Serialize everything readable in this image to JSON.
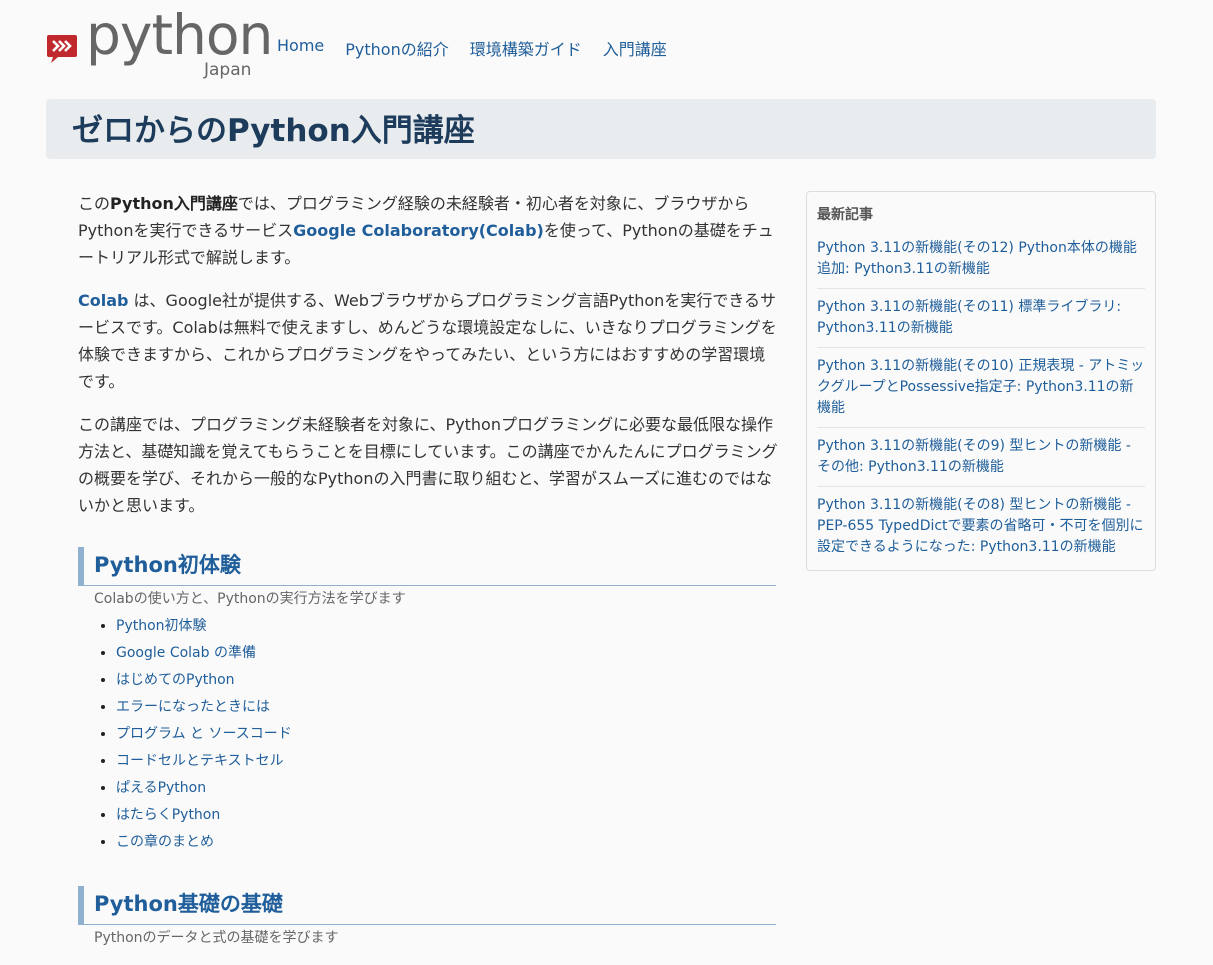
{
  "logo": {
    "word": "python",
    "sub": "Japan"
  },
  "nav": [
    "Home",
    "Pythonの紹介",
    "環境構築ガイド",
    "入門講座"
  ],
  "page_title": "ゼロからのPython入門講座",
  "intro": {
    "p1_a": "この",
    "p1_bold": "Python入門講座",
    "p1_b": "では、プログラミング経験の未経験者・初心者を対象に、ブラウザからPythonを実行できるサービス",
    "p1_link": "Google Colaboratory(Colab)",
    "p1_c": "を使って、Pythonの基礎をチュートリアル形式で解説します。",
    "p2_link": "Colab",
    "p2_text": " は、Google社が提供する、Webブラウザからプログラミング言語Pythonを実行できるサービスです。Colabは無料で使えますし、めんどうな環境設定なしに、いきなりプログラミングを体験できますから、これからプログラミングをやってみたい、という方にはおすすめの学習環境です。",
    "p3": "この講座では、プログラミング未経験者を対象に、Pythonプログラミングに必要な最低限な操作方法と、基礎知識を覚えてもらうことを目標にしています。この講座でかんたんにプログラミングの概要を学び、それから一般的なPythonの入門書に取り組むと、学習がスムーズに進むのではないかと思います。"
  },
  "sections": [
    {
      "title": "Python初体験",
      "desc": "Colabの使い方と、Pythonの実行方法を学びます",
      "items": [
        "Python初体験",
        "Google Colab の準備",
        "はじめてのPython",
        "エラーになったときには",
        "プログラム と ソースコード",
        "コードセルとテキストセル",
        "ぱえるPython",
        "はたらくPython",
        "この章のまとめ"
      ]
    },
    {
      "title": "Python基礎の基礎",
      "desc": "Pythonのデータと式の基礎を学びます",
      "items": []
    }
  ],
  "sidebar": {
    "heading": "最新記事",
    "items": [
      "Python 3.11の新機能(その12) Python本体の機能追加: Python3.11の新機能",
      "Python 3.11の新機能(その11) 標準ライブラリ: Python3.11の新機能",
      "Python 3.11の新機能(その10) 正規表現 - アトミックグループとPossessive指定子: Python3.11の新機能",
      "Python 3.11の新機能(その9) 型ヒントの新機能 - その他: Python3.11の新機能",
      "Python 3.11の新機能(その8) 型ヒントの新機能 - PEP-655 TypedDictで要素の省略可・不可を個別に設定できるようになった: Python3.11の新機能"
    ]
  },
  "colors": {
    "link": "#1f5e9a",
    "title": "#1d3c5c",
    "badge": "#c0282d"
  }
}
